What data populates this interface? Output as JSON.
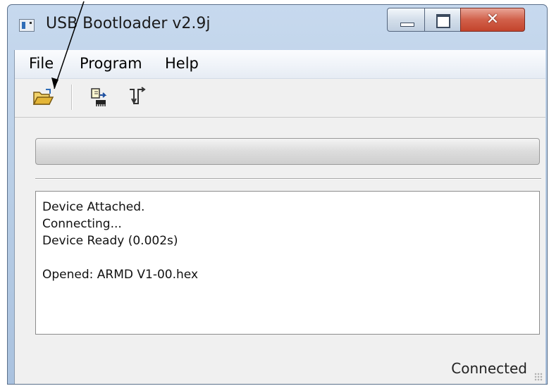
{
  "window": {
    "title": "USB Bootloader v2.9j"
  },
  "window_controls": {
    "close_glyph": "✕"
  },
  "menu": [
    "File",
    "Program",
    "Help"
  ],
  "toolbar": {
    "buttons": [
      {
        "icon": "open-folder-icon"
      },
      {
        "icon": "program-device-icon"
      },
      {
        "icon": "reset-device-icon"
      }
    ]
  },
  "progress": {
    "value": 0
  },
  "log": {
    "lines": [
      "Device Attached.",
      "Connecting...",
      "Device Ready (0.002s)",
      "",
      "Opened: ARMD V1-00.hex"
    ]
  },
  "status": {
    "text": "Connected"
  },
  "colors": {
    "accent": "#2f6db7",
    "close_button": "#c3442c",
    "annotation_arrow": "#000000"
  }
}
